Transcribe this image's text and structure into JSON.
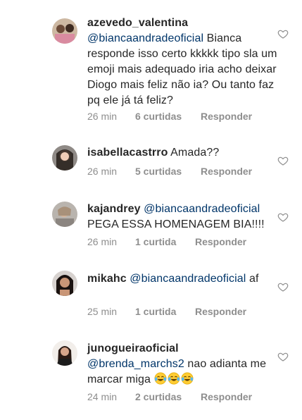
{
  "comments": [
    {
      "user": "azevedo_valentina",
      "mention": "@biancaandradeoficial",
      "text": " Bianca responde isso certo kkkkk tipo sla um emoji mais adequado iria acho deixar Diogo mais feliz não ia? Ou tanto faz pq ele já tá feliz?",
      "time": "26 min",
      "likes": "6 curtidas",
      "reply": "Responder",
      "avatar_icon": "profile-photo"
    },
    {
      "user": "isabellacastrro",
      "mention": "",
      "text": "Amada??",
      "time": "26 min",
      "likes": "5 curtidas",
      "reply": "Responder",
      "avatar_icon": "profile-photo"
    },
    {
      "user": "kajandrey",
      "mention": "@biancaandradeoficial",
      "text": " PEGA ESSA HOMENAGEM BIA!!!!",
      "time": "26 min",
      "likes": "1 curtida",
      "reply": "Responder",
      "avatar_icon": "profile-photo"
    },
    {
      "user": "mikahc",
      "mention": "@biancaandradeoficial",
      "text": " af",
      "time": "25 min",
      "likes": "1 curtida",
      "reply": "Responder",
      "avatar_icon": "profile-photo"
    },
    {
      "user": "junogueiraoficial",
      "mention": "@brenda_marchs2",
      "text": " nao adianta me marcar miga",
      "emojis": [
        "face-with-tears-of-joy",
        "face-with-tears-of-joy",
        "face-with-tears-of-joy"
      ],
      "time": "24 min",
      "likes": "2 curtidas",
      "reply": "Responder",
      "avatar_icon": "profile-photo"
    }
  ],
  "colors": {
    "mention": "#003569",
    "meta": "#8e8e8e",
    "text": "#262626"
  },
  "icons": {
    "like": "heart-outline-icon"
  }
}
